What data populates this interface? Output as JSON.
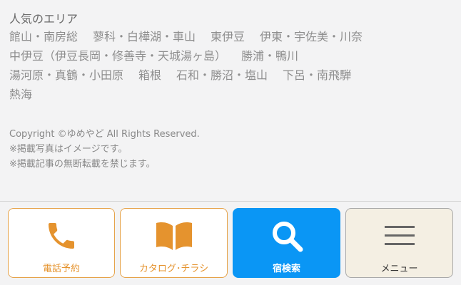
{
  "popular_areas": {
    "heading": "人気のエリア",
    "rows": [
      [
        "館山・南房総",
        "蓼科・白樺湖・車山",
        "東伊豆",
        "伊東・宇佐美・川奈"
      ],
      [
        "中伊豆（伊豆長岡・修善寺・天城湯ヶ島）",
        "勝浦・鴨川"
      ],
      [
        "湯河原・真鶴・小田原",
        "箱根",
        "石和・勝沼・塩山",
        "下呂・南飛騨"
      ],
      [
        "熱海"
      ]
    ]
  },
  "footer": {
    "copyright": "Copyright ©ゆめやど All Rights Reserved.",
    "note_photos": "※掲載写真はイメージです。",
    "note_reprint": "※掲載記事の無断転載を禁じます。"
  },
  "bottom_nav": {
    "phone_label": "電話予約",
    "catalog_label": "カタログ･チラシ",
    "search_label": "宿検索",
    "menu_label": "メニュー"
  },
  "colors": {
    "accent_orange": "#e5932e",
    "accent_blue": "#0a96f5",
    "menu_bg": "#f4efe3"
  },
  "icons": {
    "phone": "phone-icon",
    "catalog": "book-icon",
    "search": "search-icon",
    "menu": "hamburger-icon"
  }
}
